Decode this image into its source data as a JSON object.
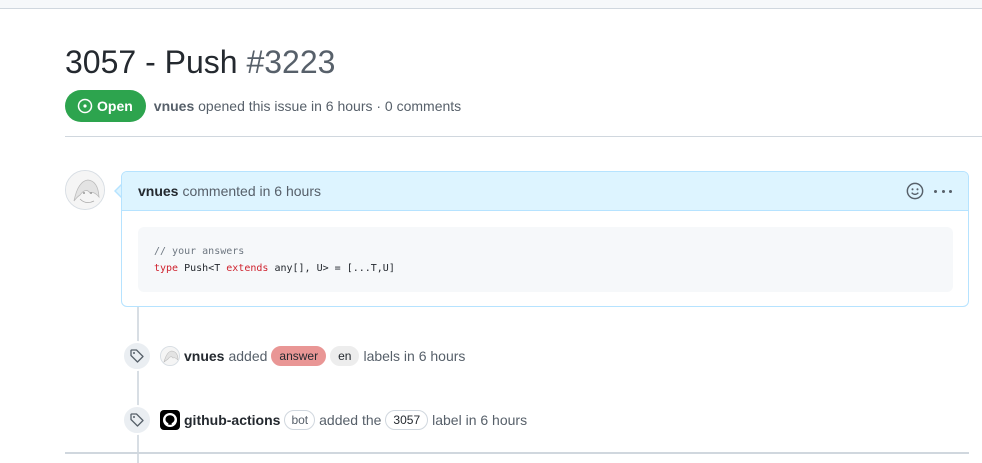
{
  "issue": {
    "title": "3057 - Push",
    "number": "#3223",
    "state": "Open",
    "author": "vnues",
    "meta": "opened this issue in 6 hours · 0 comments"
  },
  "comment": {
    "author": "vnues",
    "meta": "commented in 6 hours",
    "code_line1": "// your answers",
    "code_kw1": "type",
    "code_mid": " Push<T ",
    "code_kw2": "extends",
    "code_rest": " any[], U> = [...T,U]"
  },
  "events": [
    {
      "actor": "vnues",
      "text_before": "added",
      "labels": [
        "answer",
        "en"
      ],
      "text_after": "labels in 6 hours",
      "icon": "tag-icon"
    },
    {
      "actor": "github-actions",
      "badge": "bot",
      "text_before": "added the",
      "labels": [
        "3057"
      ],
      "text_after": "label in 6 hours",
      "icon": "tag-icon"
    }
  ],
  "colors": {
    "open_green": "#2da44e",
    "comment_header_bg": "#ddf4ff",
    "label_answer": "#e99695",
    "label_en": "#ededed"
  }
}
